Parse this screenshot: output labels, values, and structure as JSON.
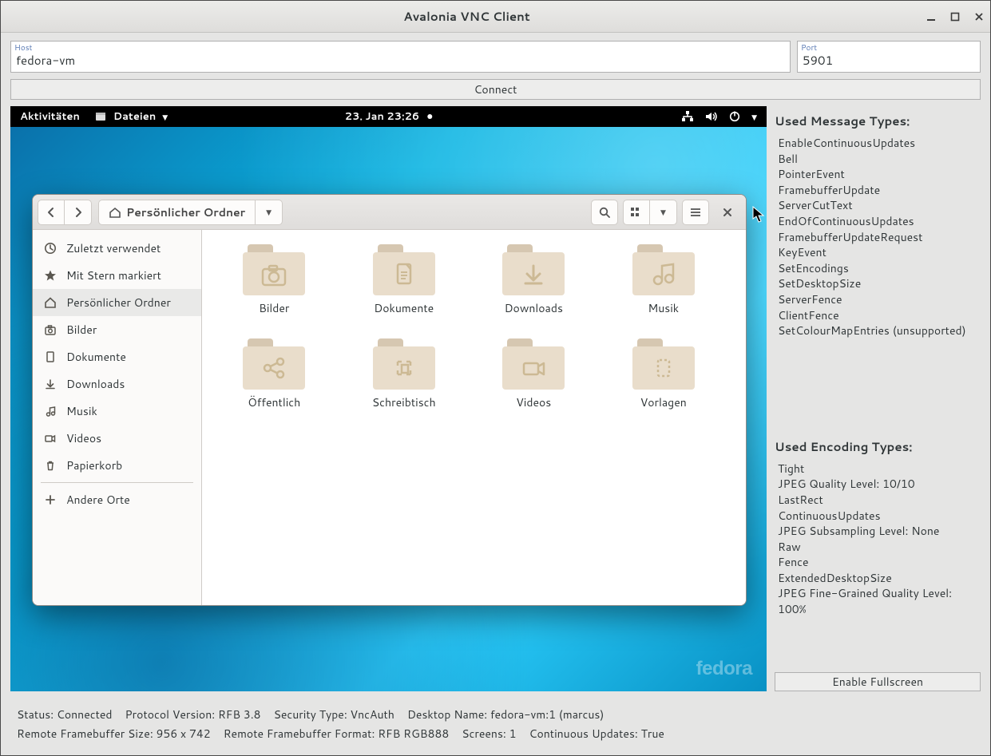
{
  "window": {
    "title": "Avalonia VNC Client"
  },
  "conn": {
    "host_label": "Host",
    "host_value": "fedora-vm",
    "port_label": "Port",
    "port_value": "5901",
    "connect_label": "Connect"
  },
  "gnome": {
    "activities": "Aktivitäten",
    "app_name": "Dateien",
    "clock": "23. Jan  23:26"
  },
  "nautilus": {
    "path_label": "Persönlicher Ordner",
    "sidebar": [
      {
        "icon": "clock",
        "label": "Zuletzt verwendet"
      },
      {
        "icon": "star",
        "label": "Mit Stern markiert"
      },
      {
        "icon": "home",
        "label": "Persönlicher Ordner",
        "selected": true
      },
      {
        "icon": "camera",
        "label": "Bilder"
      },
      {
        "icon": "doc",
        "label": "Dokumente"
      },
      {
        "icon": "down",
        "label": "Downloads"
      },
      {
        "icon": "music",
        "label": "Musik"
      },
      {
        "icon": "video",
        "label": "Videos"
      },
      {
        "icon": "trash",
        "label": "Papierkorb"
      },
      {
        "icon": "plus",
        "label": "Andere Orte",
        "sep_before": true
      }
    ],
    "folders": [
      {
        "glyph": "camera",
        "label": "Bilder"
      },
      {
        "glyph": "doc",
        "label": "Dokumente"
      },
      {
        "glyph": "down",
        "label": "Downloads"
      },
      {
        "glyph": "music",
        "label": "Musik"
      },
      {
        "glyph": "share",
        "label": "Öffentlich"
      },
      {
        "glyph": "select",
        "label": "Schreibtisch"
      },
      {
        "glyph": "video",
        "label": "Videos"
      },
      {
        "glyph": "tmpl",
        "label": "Vorlagen"
      }
    ]
  },
  "msgtypes": {
    "header": "Used Message Types:",
    "items": [
      "EnableContinuousUpdates",
      "Bell",
      "PointerEvent",
      "FramebufferUpdate",
      "ServerCutText",
      "EndOfContinuousUpdates",
      "FramebufferUpdateRequest",
      "KeyEvent",
      "SetEncodings",
      "SetDesktopSize",
      "ServerFence",
      "ClientFence",
      "SetColourMapEntries (unsupported)"
    ]
  },
  "enctypes": {
    "header": "Used Encoding Types:",
    "items": [
      "Tight",
      "JPEG Quality Level: 10/10",
      "LastRect",
      "ContinuousUpdates",
      "JPEG Subsampling Level: None",
      "Raw",
      "Fence",
      "ExtendedDesktopSize",
      "JPEG Fine-Grained Quality Level: 100%"
    ]
  },
  "fullscreen_label": "Enable Fullscreen",
  "fedora_watermark": "fedora",
  "status": {
    "line1": [
      "Status: Connected",
      "Protocol Version: RFB 3.8",
      "Security Type: VncAuth",
      "Desktop Name: fedora-vm:1 (marcus)"
    ],
    "line2": [
      "Remote Framebuffer Size: 956 x 742",
      "Remote Framebuffer Format: RFB RGB888",
      "Screens: 1",
      "Continuous Updates: True"
    ]
  }
}
